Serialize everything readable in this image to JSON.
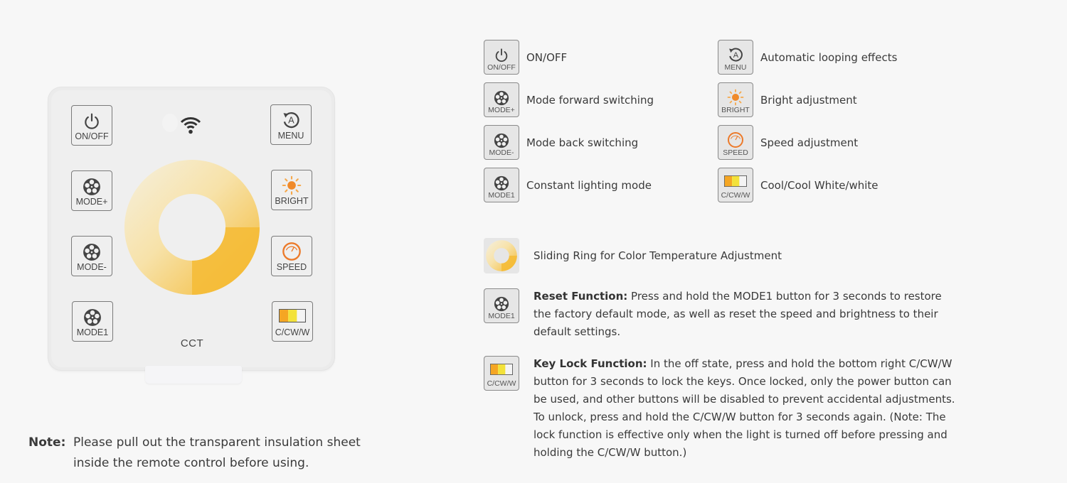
{
  "remote": {
    "keys_left": [
      {
        "id": "onoff",
        "label": "ON/OFF",
        "icon": "power-icon"
      },
      {
        "id": "mode-plus",
        "label": "MODE+",
        "icon": "film-reel-icon"
      },
      {
        "id": "mode-minus",
        "label": "MODE-",
        "icon": "film-reel-icon"
      },
      {
        "id": "mode1",
        "label": "MODE1",
        "icon": "film-reel-icon"
      }
    ],
    "keys_right": [
      {
        "id": "menu",
        "label": "MENU",
        "icon": "auto-loop-icon"
      },
      {
        "id": "bright",
        "label": "BRIGHT",
        "icon": "sun-icon"
      },
      {
        "id": "speed",
        "label": "SPEED",
        "icon": "speedometer-icon"
      },
      {
        "id": "ccww",
        "label": "C/CW/W",
        "icon": "color-bar-icon"
      }
    ],
    "model_label": "CCT",
    "colors": {
      "ring_cool": "#f4efe2",
      "ring_warm": "#f3bd3a",
      "accent_orange": "#f08a2a",
      "bar_orange": "#f5a623",
      "bar_yellow": "#f3e23a",
      "bar_white": "#f4f4f4"
    }
  },
  "legend": [
    {
      "key_label": "ON/OFF",
      "icon": "power-icon",
      "text": "ON/OFF"
    },
    {
      "key_label": "MODE+",
      "icon": "film-reel-icon",
      "text": "Mode forward switching"
    },
    {
      "key_label": "MODE-",
      "icon": "film-reel-icon",
      "text": "Mode back switching"
    },
    {
      "key_label": "MODE1",
      "icon": "film-reel-icon",
      "text": "Constant lighting mode"
    },
    {
      "key_label": "MENU",
      "icon": "auto-loop-icon",
      "text": "Automatic looping effects"
    },
    {
      "key_label": "BRIGHT",
      "icon": "sun-icon",
      "text": "Bright adjustment"
    },
    {
      "key_label": "SPEED",
      "icon": "speedometer-icon",
      "text": "Speed adjustment"
    },
    {
      "key_label": "C/CW/W",
      "icon": "color-bar-icon",
      "text": "Cool/Cool White/white"
    }
  ],
  "ring_item": {
    "icon": "sliding-ring-icon",
    "text": "Sliding Ring for Color Temperature Adjustment"
  },
  "functions": {
    "reset": {
      "key_label": "MODE1",
      "title": "Reset Function:",
      "body": " Press and hold the MODE1 button for 3 seconds to restore the factory default mode, as well as reset the speed and brightness to their default settings."
    },
    "keylock": {
      "key_label": "C/CW/W",
      "title": "Key Lock Function:",
      "body": " In the off state, press and hold the bottom right C/CW/W button for 3 seconds to lock the keys. Once locked, only the power button can be used, and other buttons will be disabled to prevent accidental adjustments. To unlock, press and hold the C/CW/W button for 3 seconds again. (Note: The lock function is effective only when the light is turned off before pressing and holding the C/CW/W button.)"
    }
  },
  "note": {
    "label": "Note:",
    "text": "Please pull out the transparent insulation sheet inside the remote control before using."
  }
}
